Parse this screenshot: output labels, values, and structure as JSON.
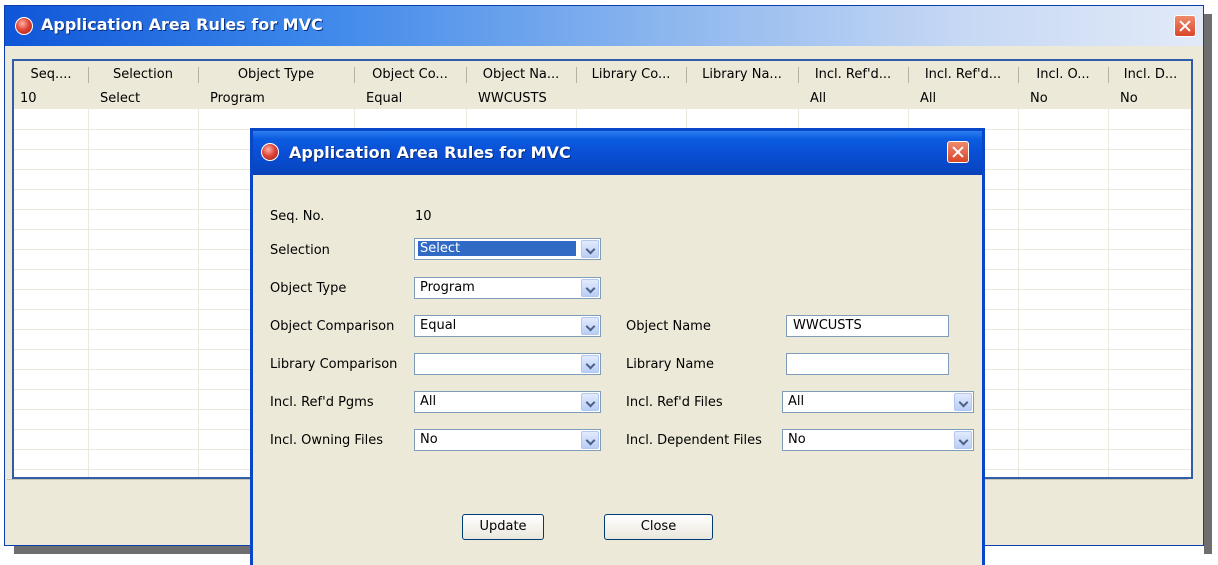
{
  "window": {
    "title": "Application Area Rules for MVC"
  },
  "grid": {
    "columns": [
      "Seq....",
      "Selection",
      "Object Type",
      "Object Co...",
      "Object Na...",
      "Library Co...",
      "Library Na...",
      "Incl. Ref'd...",
      "Incl. Ref'd...",
      "Incl. O...",
      "Incl. D..."
    ],
    "rows": [
      [
        "10",
        "Select",
        "Program",
        "Equal",
        "WWCUSTS",
        "",
        "",
        "All",
        "All",
        "No",
        "No"
      ]
    ]
  },
  "dialog": {
    "title": "Application Area Rules for MVC",
    "seq_label": "Seq. No.",
    "seq_value": "10",
    "selection_label": "Selection",
    "selection_value": "Select",
    "object_type_label": "Object Type",
    "object_type_value": "Program",
    "object_comparison_label": "Object Comparison",
    "object_comparison_value": "Equal",
    "object_name_label": "Object Name",
    "object_name_value": "WWCUSTS",
    "library_comparison_label": "Library Comparison",
    "library_comparison_value": "",
    "library_name_label": "Library Name",
    "library_name_value": "",
    "incl_refd_pgms_label": "Incl. Ref'd Pgms",
    "incl_refd_pgms_value": "All",
    "incl_refd_files_label": "Incl. Ref'd Files",
    "incl_refd_files_value": "All",
    "incl_owning_files_label": "Incl. Owning Files",
    "incl_owning_files_value": "No",
    "incl_dependent_files_label": "Incl. Dependent Files",
    "incl_dependent_files_value": "No",
    "update_label": "Update",
    "close_label": "Close"
  },
  "colors": {
    "titlebar_blue": "#0a4fd6",
    "selection_highlight": "#316ac5",
    "window_face": "#ece9d8",
    "close_button_red": "#d9462a"
  },
  "icons": [
    "app-icon",
    "close-icon",
    "chevron-down-icon"
  ]
}
